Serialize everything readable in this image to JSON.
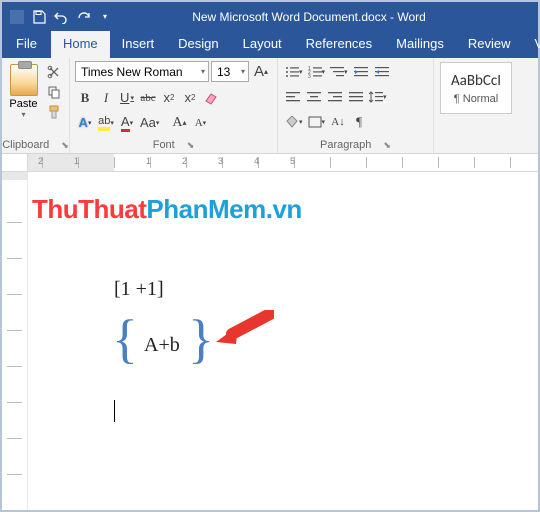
{
  "titlebar": {
    "title": "New Microsoft Word Document.docx - Word"
  },
  "tabs": {
    "file": "File",
    "home": "Home",
    "insert": "Insert",
    "design": "Design",
    "layout": "Layout",
    "references": "References",
    "mailings": "Mailings",
    "review": "Review",
    "view": "View"
  },
  "clipboard": {
    "paste": "Paste",
    "label": "Clipboard"
  },
  "font": {
    "name": "Times New Roman",
    "size": "13",
    "label": "Font",
    "bold": "B",
    "italic": "I",
    "underline": "U",
    "strike": "abc",
    "sub": "x",
    "sup": "x",
    "texteffects": "A",
    "highlight": "ab",
    "fontcolor": "A",
    "changecase": "Aa",
    "grow": "A",
    "shrink": "A",
    "clear": "A"
  },
  "para": {
    "label": "Paragraph"
  },
  "styles": {
    "sample": "AaBbCcI",
    "name": "¶ Normal"
  },
  "watermark": {
    "part1": "ThuThuat",
    "part2": "PhanMem",
    "part3": ".vn"
  },
  "document": {
    "line1": "[1 +1]",
    "line2": "A+b"
  },
  "ruler": {
    "labels": [
      "2",
      "1",
      "1",
      "2",
      "3",
      "4",
      "5"
    ]
  }
}
